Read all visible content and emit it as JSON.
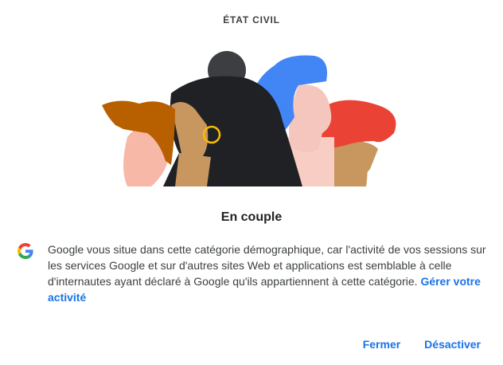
{
  "header": {
    "eyebrow": "ÉTAT CIVIL"
  },
  "status": {
    "title": "En couple"
  },
  "info": {
    "icon": "google-g-logo",
    "text": "Google vous situe dans cette catégorie démographique, car l'activité de vos sessions sur les services Google et sur d'autres sites Web et applications est semblable à celle d'internautes ayant déclaré à Google qu'ils appartiennent à cette catégorie. ",
    "link": "Gérer votre activité"
  },
  "actions": {
    "close_label": "Fermer",
    "disable_label": "Désactiver"
  },
  "colors": {
    "accent": "#1a73e8",
    "text": "#3c4043"
  }
}
